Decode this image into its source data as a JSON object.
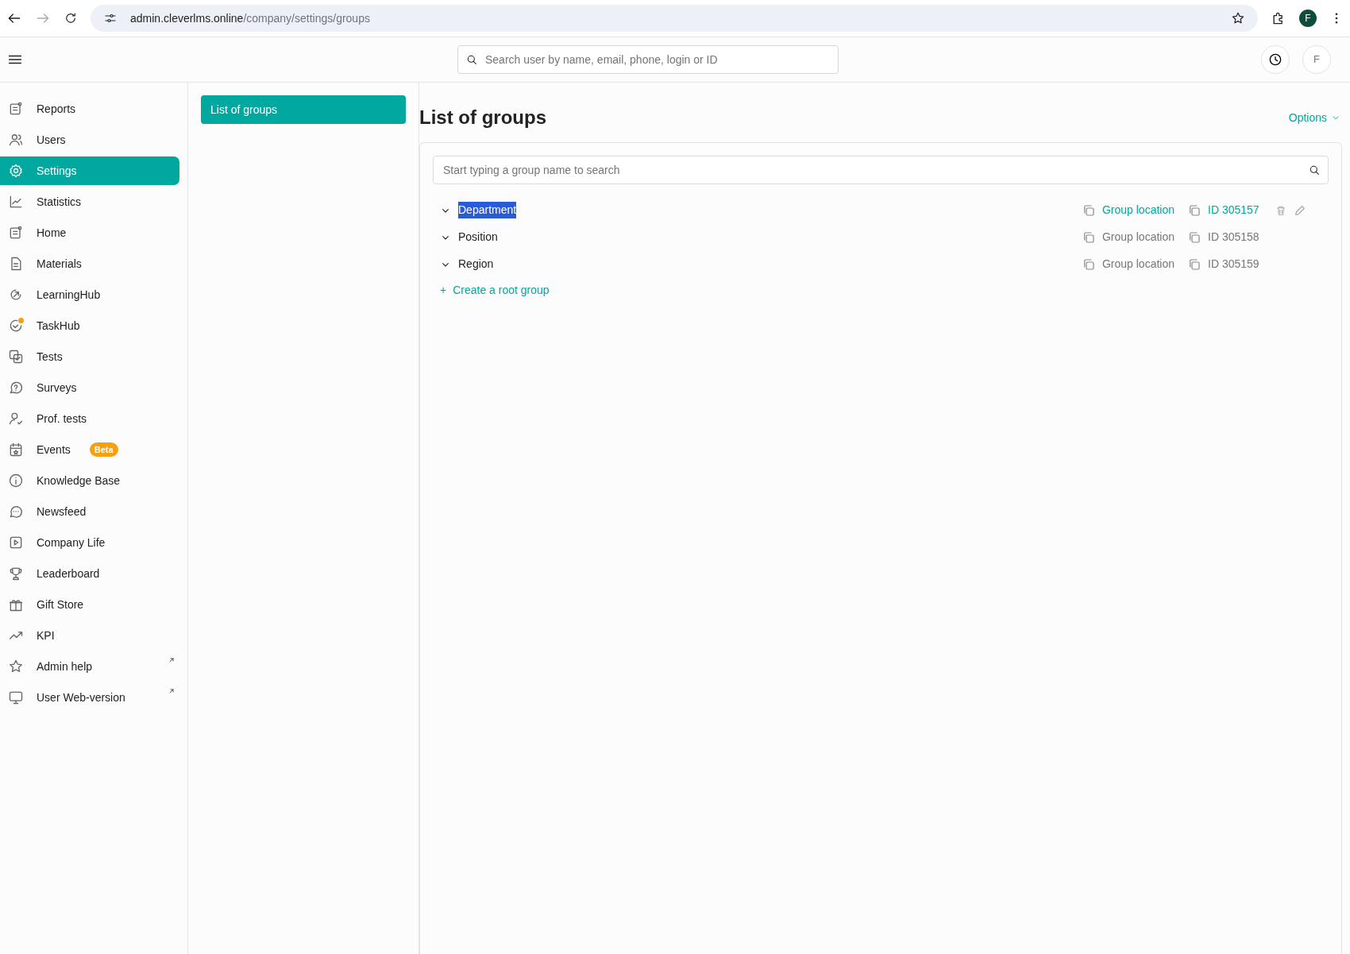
{
  "browser": {
    "url_host": "admin.cleverlms.online",
    "url_path": "/company/settings/groups",
    "profile_initial": "F"
  },
  "header": {
    "search_placeholder": "Search user by name, email, phone, login or ID",
    "avatar_initial": "F"
  },
  "sidebar": {
    "items": [
      {
        "label": "Reports",
        "selected": false
      },
      {
        "label": "Users",
        "selected": false
      },
      {
        "label": "Settings",
        "selected": true
      },
      {
        "label": "Statistics",
        "selected": false
      },
      {
        "label": "Home",
        "selected": false
      },
      {
        "label": "Materials",
        "selected": false
      },
      {
        "label": "LearningHub",
        "selected": false
      },
      {
        "label": "TaskHub",
        "selected": false,
        "notification": true
      },
      {
        "label": "Tests",
        "selected": false
      },
      {
        "label": "Surveys",
        "selected": false
      },
      {
        "label": "Prof. tests",
        "selected": false
      },
      {
        "label": "Events",
        "selected": false,
        "badge": "Beta"
      },
      {
        "label": "Knowledge Base",
        "selected": false
      },
      {
        "label": "Newsfeed",
        "selected": false
      },
      {
        "label": "Company Life",
        "selected": false
      },
      {
        "label": "Leaderboard",
        "selected": false
      },
      {
        "label": "Gift Store",
        "selected": false
      },
      {
        "label": "KPI",
        "selected": false
      },
      {
        "label": "Admin help",
        "selected": false,
        "external": true
      },
      {
        "label": "User Web-version",
        "selected": false,
        "external": true
      }
    ]
  },
  "subnav": {
    "items": [
      {
        "label": "List of groups",
        "selected": true
      }
    ]
  },
  "page": {
    "title": "List of groups",
    "options": "Options",
    "search_placeholder": "Start typing a group name to search",
    "groups": [
      {
        "name": "Department",
        "location": "Group location",
        "id": "ID 305157",
        "hovered": true,
        "name_selected": true
      },
      {
        "name": "Position",
        "location": "Group location",
        "id": "ID 305158",
        "hovered": false,
        "name_selected": false
      },
      {
        "name": "Region",
        "location": "Group location",
        "id": "ID 305159",
        "hovered": false,
        "name_selected": false
      }
    ],
    "create": {
      "icon": "+",
      "label": "Create a root group"
    }
  }
}
